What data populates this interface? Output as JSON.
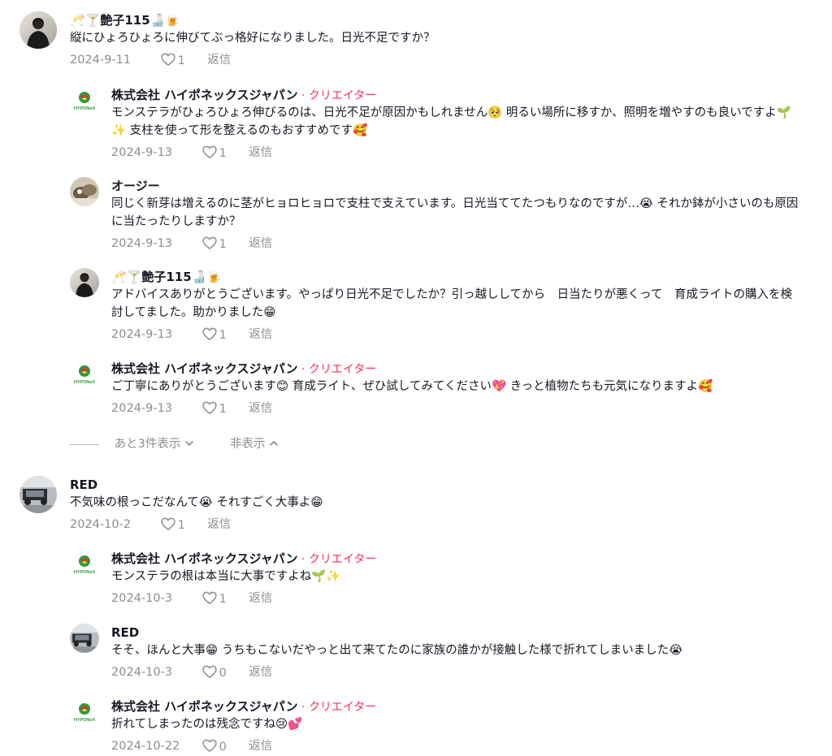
{
  "comments": [
    {
      "author": "🥂🍸艶子115🍶🍺",
      "creator": "",
      "text": "縦にひょろひょろに伸びてぶっ格好になりました。日光不足ですか？",
      "date": "2024-9-11",
      "likes": "1",
      "reply": "返信"
    },
    {
      "author": "株式会社 ハイポネックスジャパン",
      "creator": " · クリエイター",
      "text": "モンステラがひょろひょろ伸びるのは、日光不足が原因かもしれません🥺 明るい場所に移すか、照明を増やすのも良いですよ🌱✨ 支柱を使って形を整えるのもおすすめです🥰",
      "date": "2024-9-13",
      "likes": "1",
      "reply": "返信"
    },
    {
      "author": "オージー",
      "creator": "",
      "text": "同じく新芽は増えるのに茎がヒョロヒョロで支柱で支えています。日光当ててたつもりなのですが…😭 それか鉢が小さいのも原因に当たったりしますか？",
      "date": "2024-9-13",
      "likes": "1",
      "reply": "返信"
    },
    {
      "author": "🥂🍸艶子115🍶🍺",
      "creator": "",
      "text": "アドバイスありがとうございます。やっぱり日光不足でしたか？引っ越ししてから　日当たりが悪くって　育成ライトの購入を検討してました。助かりました😁",
      "date": "2024-9-13",
      "likes": "1",
      "reply": "返信"
    },
    {
      "author": "株式会社 ハイポネックスジャパン",
      "creator": " · クリエイター",
      "text": "ご丁寧にありがとうございます😊 育成ライト、ぜひ試してみてください💖 きっと植物たちも元気になりますよ🥰",
      "date": "2024-9-13",
      "likes": "1",
      "reply": "返信"
    },
    {
      "author": "RED",
      "creator": "",
      "text": "不気味の根っこだなんて😭 それすごく大事よ😁",
      "date": "2024-10-2",
      "likes": "1",
      "reply": "返信"
    },
    {
      "author": "株式会社 ハイポネックスジャパン",
      "creator": " · クリエイター",
      "text": "モンステラの根は本当に大事ですよね🌱✨",
      "date": "2024-10-3",
      "likes": "1",
      "reply": "返信"
    },
    {
      "author": "RED",
      "creator": "",
      "text": "そそ、ほんと大事😁 うちもこないだやっと出て来てたのに家族の誰かが接触した様で折れてしまいました😭",
      "date": "2024-10-3",
      "likes": "0",
      "reply": "返信"
    },
    {
      "author": "株式会社 ハイポネックスジャパン",
      "creator": " · クリエイター",
      "text": "折れてしまったのは残念ですね😢💕",
      "date": "2024-10-22",
      "likes": "0",
      "reply": "返信"
    }
  ],
  "expander": {
    "more": "あと3件表示",
    "hide": "非表示"
  },
  "colors": {
    "creator": "#fe2c55",
    "meta": "#8a8b91",
    "brand_green": "#2e9a3a"
  },
  "icons": {
    "like": "heart-outline-icon",
    "more": "chevron-down-icon",
    "hide": "chevron-up-icon"
  }
}
